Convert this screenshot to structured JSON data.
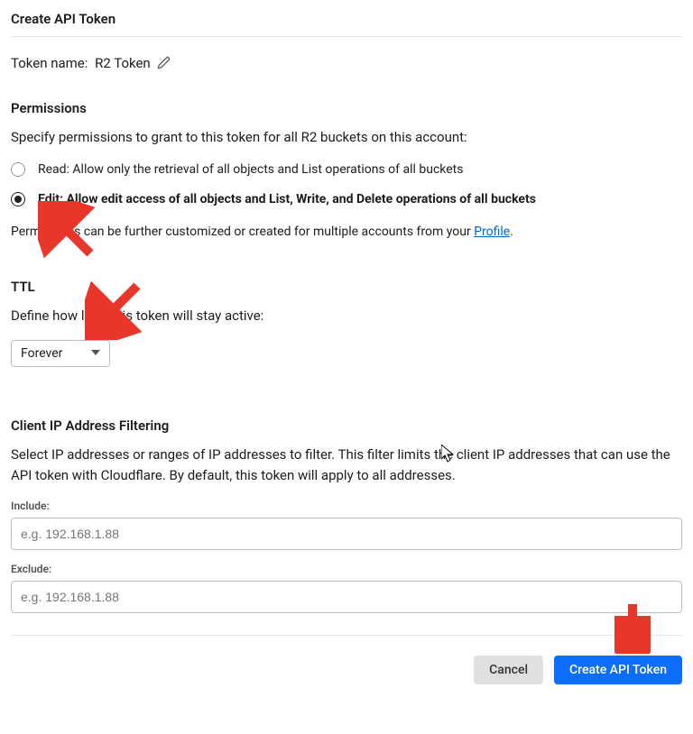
{
  "page_title": "Create API Token",
  "token_name": {
    "label": "Token name:",
    "value": "R2 Token"
  },
  "permissions": {
    "heading": "Permissions",
    "desc": "Specify permissions to grant to this token for all R2 buckets on this account:",
    "opt_read": "Read: Allow only the retrieval of all objects and List operations of all buckets",
    "opt_edit": "Edit: Allow edit access of all objects and List, Write, and Delete operations of all buckets",
    "note_prefix": "Permissions can be further customized or created for multiple accounts from your ",
    "note_link": "Profile",
    "note_suffix": "."
  },
  "ttl": {
    "heading": "TTL",
    "desc": "Define how long this token will stay active:",
    "selected": "Forever"
  },
  "ip_filter": {
    "heading": "Client IP Address Filtering",
    "desc": "Select IP addresses or ranges of IP addresses to filter. This filter limits the client IP addresses that can use the API token with Cloudflare. By default, this token will apply to all addresses.",
    "include_label": "Include:",
    "include_placeholder": "e.g. 192.168.1.88",
    "exclude_label": "Exclude:",
    "exclude_placeholder": "e.g. 192.168.1.88"
  },
  "footer": {
    "cancel": "Cancel",
    "submit": "Create API Token"
  }
}
